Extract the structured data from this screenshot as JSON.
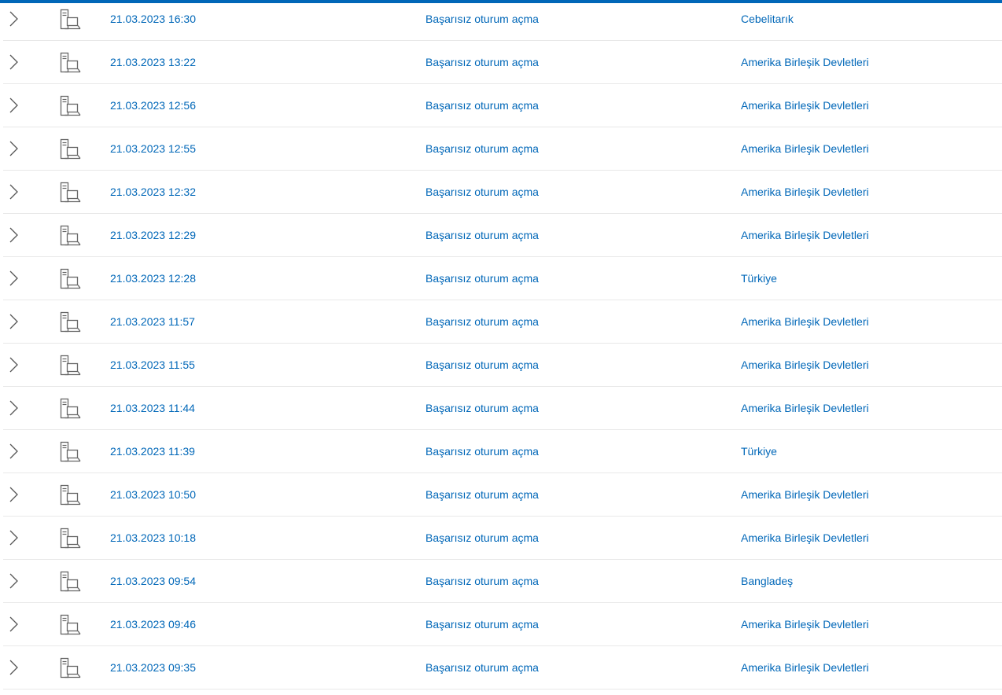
{
  "accent": "#0067b8",
  "icons": {
    "expand": "chevron-right-icon",
    "device": "desktop-computer-icon"
  },
  "rows": [
    {
      "time": "21.03.2023 16:30",
      "activity": "Başarısız oturum açma",
      "location": "Cebelitarık"
    },
    {
      "time": "21.03.2023 13:22",
      "activity": "Başarısız oturum açma",
      "location": "Amerika Birleşik Devletleri"
    },
    {
      "time": "21.03.2023 12:56",
      "activity": "Başarısız oturum açma",
      "location": "Amerika Birleşik Devletleri"
    },
    {
      "time": "21.03.2023 12:55",
      "activity": "Başarısız oturum açma",
      "location": "Amerika Birleşik Devletleri"
    },
    {
      "time": "21.03.2023 12:32",
      "activity": "Başarısız oturum açma",
      "location": "Amerika Birleşik Devletleri"
    },
    {
      "time": "21.03.2023 12:29",
      "activity": "Başarısız oturum açma",
      "location": "Amerika Birleşik Devletleri"
    },
    {
      "time": "21.03.2023 12:28",
      "activity": "Başarısız oturum açma",
      "location": "Türkiye"
    },
    {
      "time": "21.03.2023 11:57",
      "activity": "Başarısız oturum açma",
      "location": "Amerika Birleşik Devletleri"
    },
    {
      "time": "21.03.2023 11:55",
      "activity": "Başarısız oturum açma",
      "location": "Amerika Birleşik Devletleri"
    },
    {
      "time": "21.03.2023 11:44",
      "activity": "Başarısız oturum açma",
      "location": "Amerika Birleşik Devletleri"
    },
    {
      "time": "21.03.2023 11:39",
      "activity": "Başarısız oturum açma",
      "location": "Türkiye"
    },
    {
      "time": "21.03.2023 10:50",
      "activity": "Başarısız oturum açma",
      "location": "Amerika Birleşik Devletleri"
    },
    {
      "time": "21.03.2023 10:18",
      "activity": "Başarısız oturum açma",
      "location": "Amerika Birleşik Devletleri"
    },
    {
      "time": "21.03.2023 09:54",
      "activity": "Başarısız oturum açma",
      "location": "Bangladeş"
    },
    {
      "time": "21.03.2023 09:46",
      "activity": "Başarısız oturum açma",
      "location": "Amerika Birleşik Devletleri"
    },
    {
      "time": "21.03.2023 09:35",
      "activity": "Başarısız oturum açma",
      "location": "Amerika Birleşik Devletleri"
    }
  ]
}
